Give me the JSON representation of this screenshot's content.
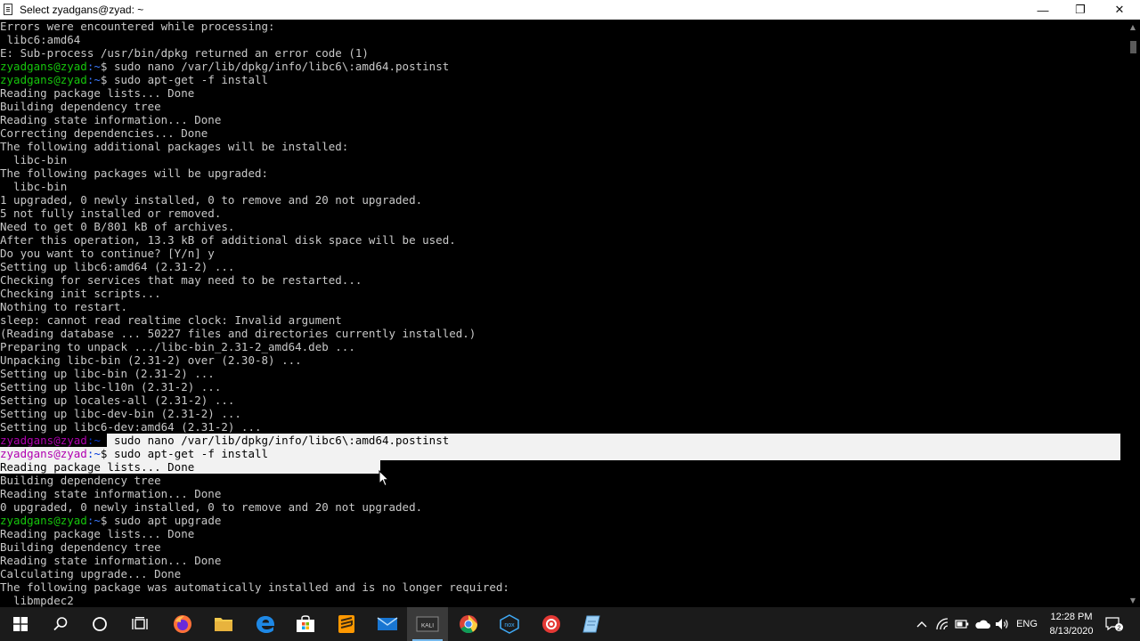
{
  "window": {
    "title": "Select zyadgans@zyad: ~",
    "minimize_glyph": "—",
    "restore_glyph": "❐",
    "close_glyph": "✕"
  },
  "terminal": {
    "lines": [
      {
        "text": "Errors were encountered while processing:"
      },
      {
        "text": " libc6:amd64"
      },
      {
        "text": "E: Sub-process /usr/bin/dpkg returned an error code (1)"
      },
      {
        "prompt": true,
        "user": "zyadgans@zyad",
        "path": ":~",
        "cmd": "$ sudo nano /var/lib/dpkg/info/libc6\\:amd64.postinst"
      },
      {
        "prompt": true,
        "user": "zyadgans@zyad",
        "path": ":~",
        "cmd": "$ sudo apt-get -f install"
      },
      {
        "text": "Reading package lists... Done"
      },
      {
        "text": "Building dependency tree"
      },
      {
        "text": "Reading state information... Done"
      },
      {
        "text": "Correcting dependencies... Done"
      },
      {
        "text": "The following additional packages will be installed:"
      },
      {
        "text": "  libc-bin"
      },
      {
        "text": "The following packages will be upgraded:"
      },
      {
        "text": "  libc-bin"
      },
      {
        "text": "1 upgraded, 0 newly installed, 0 to remove and 20 not upgraded."
      },
      {
        "text": "5 not fully installed or removed."
      },
      {
        "text": "Need to get 0 B/801 kB of archives."
      },
      {
        "text": "After this operation, 13.3 kB of additional disk space will be used."
      },
      {
        "text": "Do you want to continue? [Y/n] y"
      },
      {
        "text": "Setting up libc6:amd64 (2.31-2) ..."
      },
      {
        "text": "Checking for services that may need to be restarted..."
      },
      {
        "text": "Checking init scripts..."
      },
      {
        "text": "Nothing to restart."
      },
      {
        "text": "sleep: cannot read realtime clock: Invalid argument"
      },
      {
        "text": "(Reading database ... 50227 files and directories currently installed.)"
      },
      {
        "text": "Preparing to unpack .../libc-bin_2.31-2_amd64.deb ..."
      },
      {
        "text": "Unpacking libc-bin (2.31-2) over (2.30-8) ..."
      },
      {
        "text": "Setting up libc-bin (2.31-2) ..."
      },
      {
        "text": "Setting up libc-l10n (2.31-2) ..."
      },
      {
        "text": "Setting up locales-all (2.31-2) ..."
      },
      {
        "text": "Setting up libc-dev-bin (2.31-2) ..."
      },
      {
        "text": "Setting up libc6-dev:amd64 (2.31-2) ..."
      },
      {
        "prompt": true,
        "user": "zyadgans@zyad",
        "path": ":~",
        "cmd": "$ sudo nano /var/lib/dpkg/info/libc6\\:amd64.postinst",
        "sel": "partial-start"
      },
      {
        "prompt": true,
        "user": "zyadgans@zyad",
        "path": ":~",
        "cmd": "$ sudo apt-get -f install",
        "sel": "full"
      },
      {
        "text": "Reading package lists... Done",
        "sel": "partial-end"
      },
      {
        "text": "Building dependency tree"
      },
      {
        "text": "Reading state information... Done"
      },
      {
        "text": "0 upgraded, 0 newly installed, 0 to remove and 20 not upgraded."
      },
      {
        "prompt": true,
        "user": "zyadgans@zyad",
        "path": ":~",
        "cmd": "$ sudo apt upgrade"
      },
      {
        "text": "Reading package lists... Done"
      },
      {
        "text": "Building dependency tree"
      },
      {
        "text": "Reading state information... Done"
      },
      {
        "text": "Calculating upgrade... Done"
      },
      {
        "text": "The following package was automatically installed and is no longer required:"
      },
      {
        "text": "  libmpdec2"
      }
    ]
  },
  "scrollbar": {
    "up_glyph": "▲",
    "down_glyph": "▼"
  },
  "taskbar": {
    "apps": [
      {
        "name": "start-button",
        "icon": "windows-logo-icon"
      },
      {
        "name": "search-button",
        "icon": "search-icon"
      },
      {
        "name": "cortana-button",
        "icon": "cortana-icon"
      },
      {
        "name": "task-view-button",
        "icon": "task-view-icon"
      },
      {
        "name": "firefox-app",
        "icon": "firefox-icon"
      },
      {
        "name": "file-explorer-app",
        "icon": "folder-icon"
      },
      {
        "name": "edge-app",
        "icon": "edge-icon"
      },
      {
        "name": "store-app",
        "icon": "store-icon"
      },
      {
        "name": "sublime-app",
        "icon": "sublime-icon"
      },
      {
        "name": "mail-app",
        "icon": "mail-icon"
      },
      {
        "name": "kali-app",
        "icon": "kali-icon",
        "label": "KALI"
      },
      {
        "name": "chrome-app",
        "icon": "chrome-icon"
      },
      {
        "name": "nox-app",
        "icon": "nox-icon",
        "label": "nox"
      },
      {
        "name": "recorder-app",
        "icon": "record-icon"
      },
      {
        "name": "notes-app",
        "icon": "notepad-icon"
      }
    ],
    "tray": {
      "language": "ENG",
      "time": "12:28 PM",
      "date": "8/13/2020",
      "notification_count": "2"
    }
  },
  "colors": {
    "terminal_bg": "#000000",
    "text": "#c8c8c8",
    "prompt_user": "#16c60c",
    "prompt_path": "#3b78ff",
    "selection_bg": "#f2f2f2",
    "taskbar_bg": "#1b1b1b"
  }
}
